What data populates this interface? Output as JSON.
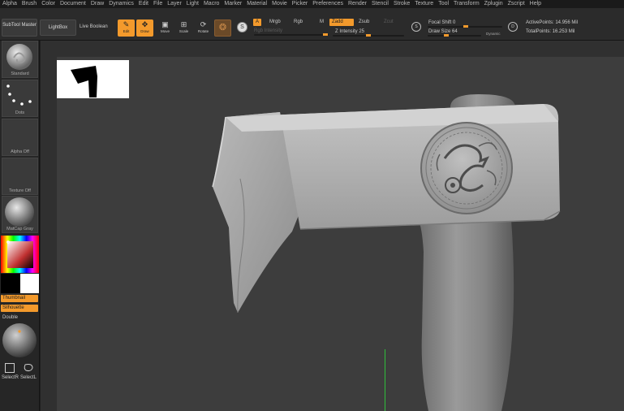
{
  "menu": [
    "Alpha",
    "Brush",
    "Color",
    "Document",
    "Draw",
    "Dynamics",
    "Edit",
    "File",
    "Layer",
    "Light",
    "Macro",
    "Marker",
    "Material",
    "Movie",
    "Picker",
    "Preferences",
    "Render",
    "Stencil",
    "Stroke",
    "Texture",
    "Tool",
    "Transform",
    "Zplugin",
    "Zscript",
    "Help"
  ],
  "toolbar": {
    "subtool_master": "SubTool Master",
    "lightbox": "LightBox",
    "live_boolean": "Live Boolean",
    "edit": "Edit",
    "draw": "Draw",
    "move": "Move",
    "scale": "Scale",
    "rotate": "Rotate",
    "a_label": "A",
    "mrgb": "Mrgb",
    "rgb": "Rgb",
    "m": "M",
    "zadd": "Zadd",
    "zsub": "Zsub",
    "zcut": "Zcut",
    "rgb_intensity": "Rgb Intensity",
    "z_intensity": "Z Intensity 25",
    "focal_shift": "Focal Shift 0",
    "draw_size": "Draw Size 64",
    "dynamic": "Dynamic",
    "active_points": "ActivePoints: 14.956 Mil",
    "total_points": "TotalPoints: 16.253 Mil"
  },
  "sliders": {
    "z_intensity_fraction": 0.25,
    "focal_shift_fraction": 0.0,
    "draw_size_fraction": 0.064
  },
  "left": {
    "standard": "Standard",
    "dots": "Dots",
    "alpha_off": "Alpha Off",
    "texture_off": "Texture Off",
    "matcap": "MatCap Gray",
    "thumbnail": "Thumbnail",
    "silhouette": "Silhouette",
    "double": "Double",
    "selectrect": "SelectR",
    "selectlasso": "SelectL"
  },
  "colors": {
    "accent": "#f39a2c",
    "bg": "#303030"
  }
}
